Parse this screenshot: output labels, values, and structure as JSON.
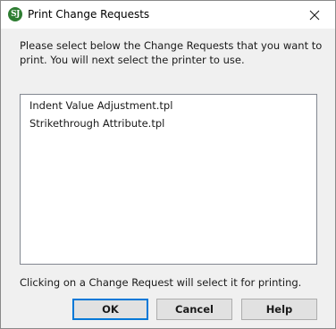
{
  "window": {
    "title": "Print Change Requests",
    "icon_text": "SJ",
    "icon_color": "#2e7d32"
  },
  "instructions": "Please select below the Change Requests that you want to\nprint.  You will next select the printer to use.",
  "list": {
    "items": [
      "Indent Value Adjustment.tpl",
      "Strikethrough Attribute.tpl"
    ]
  },
  "hint": "Clicking on a Change Request will select it for printing.",
  "buttons": {
    "ok": "OK",
    "cancel": "Cancel",
    "help": "Help"
  },
  "colors": {
    "accent": "#0078d7",
    "dialog_bg": "#f0f0f0"
  }
}
